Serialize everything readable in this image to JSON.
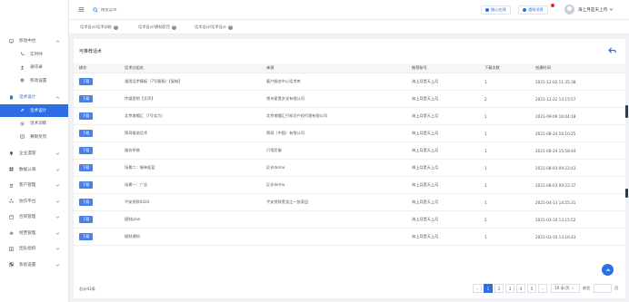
{
  "header": {
    "search_placeholder": "搜索菜单",
    "btn_contact": "微心在线",
    "btn_notice": "通知消息",
    "user_name": "海上月是天上月"
  },
  "sidebar": {
    "items": [
      {
        "label": "移动中台",
        "icon": "monitor-icon",
        "level": 0,
        "chevron": "up"
      },
      {
        "label": "实时呼",
        "icon": "phone-icon",
        "level": 1
      },
      {
        "label": "通讯录",
        "icon": "user-icon",
        "level": 1
      },
      {
        "label": "移动设置",
        "icon": "gear-icon",
        "level": 1
      },
      {
        "label": "话术设计",
        "icon": "doc-icon",
        "level": 0,
        "chevron": "up",
        "open": true
      },
      {
        "label": "话术设计",
        "icon": "pen-icon",
        "level": 1,
        "active": true
      },
      {
        "label": "话术训练",
        "icon": "target-icon",
        "level": 1
      },
      {
        "label": "赛制奖罚",
        "icon": "list-icon",
        "level": 1
      },
      {
        "label": "企业漫游",
        "icon": "pin-icon",
        "level": 0,
        "chevron": "down"
      },
      {
        "label": "数据公海",
        "icon": "grid-icon",
        "level": 0,
        "chevron": "down"
      },
      {
        "label": "客户管理",
        "icon": "users-icon",
        "level": 0,
        "chevron": "down"
      },
      {
        "label": "协作平台",
        "icon": "cluster-icon",
        "level": 0,
        "chevron": "down"
      },
      {
        "label": "合同管理",
        "icon": "contract-icon",
        "level": 0,
        "chevron": "down"
      },
      {
        "label": "经营管理",
        "icon": "chart-icon",
        "level": 0,
        "chevron": "down"
      },
      {
        "label": "团队组织",
        "icon": "team-icon",
        "level": 0,
        "chevron": "down"
      },
      {
        "label": "系统设置",
        "icon": "settings-icon",
        "level": 0,
        "chevron": "down"
      }
    ]
  },
  "tabs": [
    {
      "label": "话术设计/话术训练"
    },
    {
      "label": "话术设计/赛制奖罚"
    },
    {
      "label": "话术设计/话术设计"
    }
  ],
  "panel": {
    "title": "可推荐话术"
  },
  "table": {
    "columns": [
      "操作",
      "话术分组名",
      "来源",
      "推荐账号",
      "下载次数",
      "创建时间"
    ],
    "download_label": "下载",
    "rows": [
      [
        "通用话术模板（7号客服）【复制】",
        "客户服务中心话术库",
        "海上月是天上月",
        "1",
        "2021-12-02 11:35:38"
      ],
      [
        "传媒营销【文声】",
        "常州星雪文化有限公司",
        "海上月是天上月",
        "2",
        "2021-11-22 14:15:57"
      ],
      [
        "北京诸帽汇（7号实力）",
        "北京诸帽汇行知识产权代理有限公司",
        "海上月是天上月",
        "1",
        "2021-09-09 16:04:18"
      ],
      [
        "拜耳推说话术",
        "拜耳（中国）有限公司",
        "海上月是天上月",
        "1",
        "2021-08-24 16:10:25"
      ],
      [
        "服务举措",
        "只用民服",
        "海上月是天上月",
        "1",
        "2021-08-24 15:58:44"
      ],
      [
        "场景二：服单面蓝",
        "反诈demo",
        "海上月是天上月",
        "1",
        "2021-08-03 09:22:43"
      ],
      [
        "场景一：广告",
        "反诈demo",
        "海上月是天上月",
        "1",
        "2021-08-03 09:22:37"
      ],
      [
        "平安贷款0424",
        "平安贷款黑龙江一张家田",
        "海上月是天上月",
        "1",
        "2021-04-13 14:55:31"
      ],
      [
        "理财plan",
        "",
        "海上月是天上月",
        "2",
        "2021-03-10 13:15:52"
      ],
      [
        "理财通知",
        "",
        "海上月是天上月",
        "1",
        "2021-03-10 13:16:43"
      ]
    ]
  },
  "pagination": {
    "total_label": "总计43条",
    "pages": [
      "1",
      "2",
      "3",
      "4",
      "5"
    ],
    "current": "1",
    "page_size": "10 条/页",
    "jump_label": "前往",
    "jump_suffix": "页"
  }
}
